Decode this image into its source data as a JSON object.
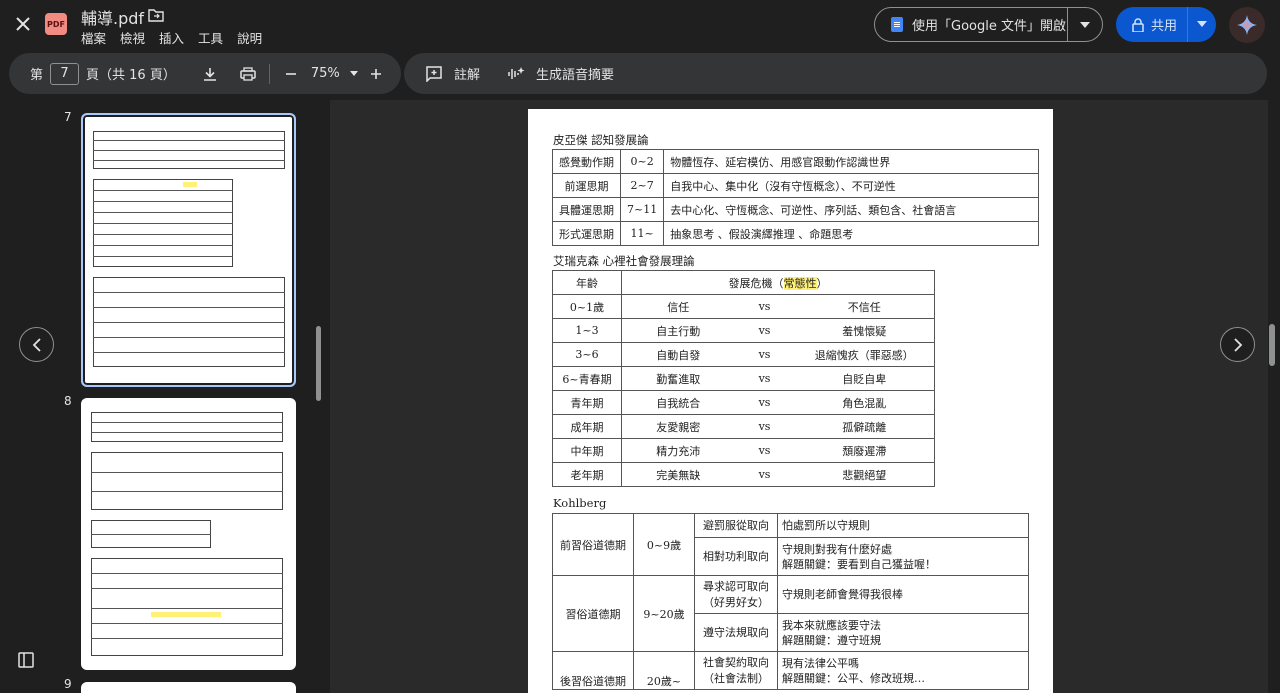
{
  "header": {
    "file_name": "輔導.pdf",
    "menu": [
      "檔案",
      "檢視",
      "插入",
      "工具",
      "說明"
    ],
    "open_with_label": "使用「Google 文件」開啟",
    "share_label": "共用",
    "pdf_badge": "PDF"
  },
  "toolbar": {
    "page_prefix": "第",
    "current_page": "7",
    "page_suffix": "頁（共 16 頁）",
    "zoom": "75%",
    "annotate_label": "註解",
    "audio_summary_label": "生成語音摘要"
  },
  "thumbnails": {
    "pages": [
      "7",
      "8",
      "9"
    ]
  },
  "document": {
    "piaget": {
      "title": "皮亞傑 認知發展論",
      "rows": [
        {
          "stage": "感覺動作期",
          "age": "0~2",
          "desc": "物體恆存、延宕模仿、用感官跟動作認識世界"
        },
        {
          "stage": "前運思期",
          "age": "2~7",
          "desc": "自我中心、集中化（沒有守恆概念）、不可逆性"
        },
        {
          "stage": "具體運思期",
          "age": "7~11",
          "desc": "去中心化、守恆概念、可逆性、序列話、類包含、社會語言"
        },
        {
          "stage": "形式運思期",
          "age": "11~",
          "desc": "抽象思考 、假設演繹推理 、命題思考"
        }
      ]
    },
    "erikson": {
      "title": "艾瑞克森 心裡社會發展理論",
      "header_age": "年齡",
      "header_crisis_prefix": "發展危機（",
      "header_crisis_highlight": "常態性",
      "header_crisis_suffix": "）",
      "rows": [
        {
          "age": "0~1歲",
          "pos": "信任",
          "vs": "vs",
          "neg": "不信任"
        },
        {
          "age": "1~3",
          "pos": "自主行動",
          "vs": "vs",
          "neg": "羞愧懷疑"
        },
        {
          "age": "3~6",
          "pos": "自動自發",
          "vs": "vs",
          "neg": "退縮愧疚（罪惡感）"
        },
        {
          "age": "6~青春期",
          "pos": "勤奮進取",
          "vs": "vs",
          "neg": "自貶自卑"
        },
        {
          "age": "青年期",
          "pos": "自我統合",
          "vs": "vs",
          "neg": "角色混亂"
        },
        {
          "age": "成年期",
          "pos": "友愛親密",
          "vs": "vs",
          "neg": "孤僻疏離"
        },
        {
          "age": "中年期",
          "pos": "精力充沛",
          "vs": "vs",
          "neg": "頹廢遲滯"
        },
        {
          "age": "老年期",
          "pos": "完美無缺",
          "vs": "vs",
          "neg": "悲觀絕望"
        }
      ]
    },
    "kohlberg": {
      "title": "Kohlberg",
      "stage1": "前習俗道德期",
      "stage1_age": "0~9歲",
      "s1o1": "避罰服從取向",
      "s1d1": "怕處罰所以守規則",
      "s1o2": "相對功利取向",
      "s1d2a": "守規則對我有什麼好處",
      "s1d2b": "解題關鍵：要看到自己獲益喔！",
      "stage2": "習俗道德期",
      "stage2_age": "9~20歲",
      "s2o1a": "尋求認可取向",
      "s2o1b": "（好男好女）",
      "s2d1": "守規則老師會覺得我很棒",
      "s2o2": "遵守法規取向",
      "s2d2a": "我本來就應該要守法",
      "s2d2b": "解題關鍵：遵守班規",
      "stage3": "後習俗道德期",
      "stage3_age": "20歲~",
      "s3o1a": "社會契約取向",
      "s3o1b": "（社會法制）",
      "s3d1a": "現有法律公平嗎",
      "s3d1b": "解題關鍵：公平、修改班規…"
    }
  }
}
